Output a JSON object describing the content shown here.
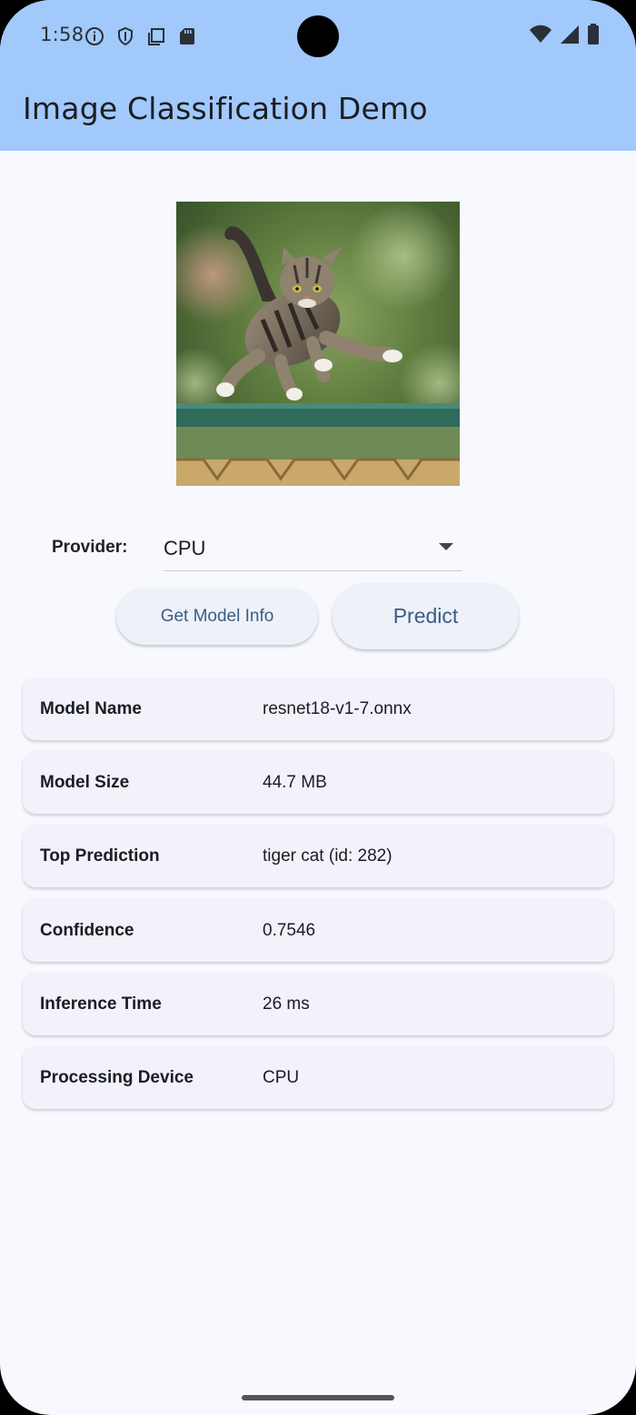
{
  "status_bar": {
    "time": "1:58",
    "left_icons": [
      "info-icon",
      "shield-icon",
      "copy-icon",
      "sd-card-icon"
    ],
    "right_icons": [
      "wifi-icon",
      "signal-icon",
      "battery-icon"
    ]
  },
  "app_bar": {
    "title": "Image Classification Demo",
    "color": "#a1c9fb"
  },
  "image": {
    "description_icon": "cat-photo"
  },
  "provider": {
    "label": "Provider:",
    "selected": "CPU"
  },
  "buttons": {
    "get_info": "Get Model Info",
    "predict": "Predict"
  },
  "results": [
    {
      "key": "Model Name",
      "value": "resnet18-v1-7.onnx"
    },
    {
      "key": "Model Size",
      "value": "44.7 MB"
    },
    {
      "key": "Top Prediction",
      "value": "tiger cat (id: 282)"
    },
    {
      "key": "Confidence",
      "value": "0.7546"
    },
    {
      "key": "Inference Time",
      "value": "26 ms"
    },
    {
      "key": "Processing Device",
      "value": "CPU"
    }
  ]
}
